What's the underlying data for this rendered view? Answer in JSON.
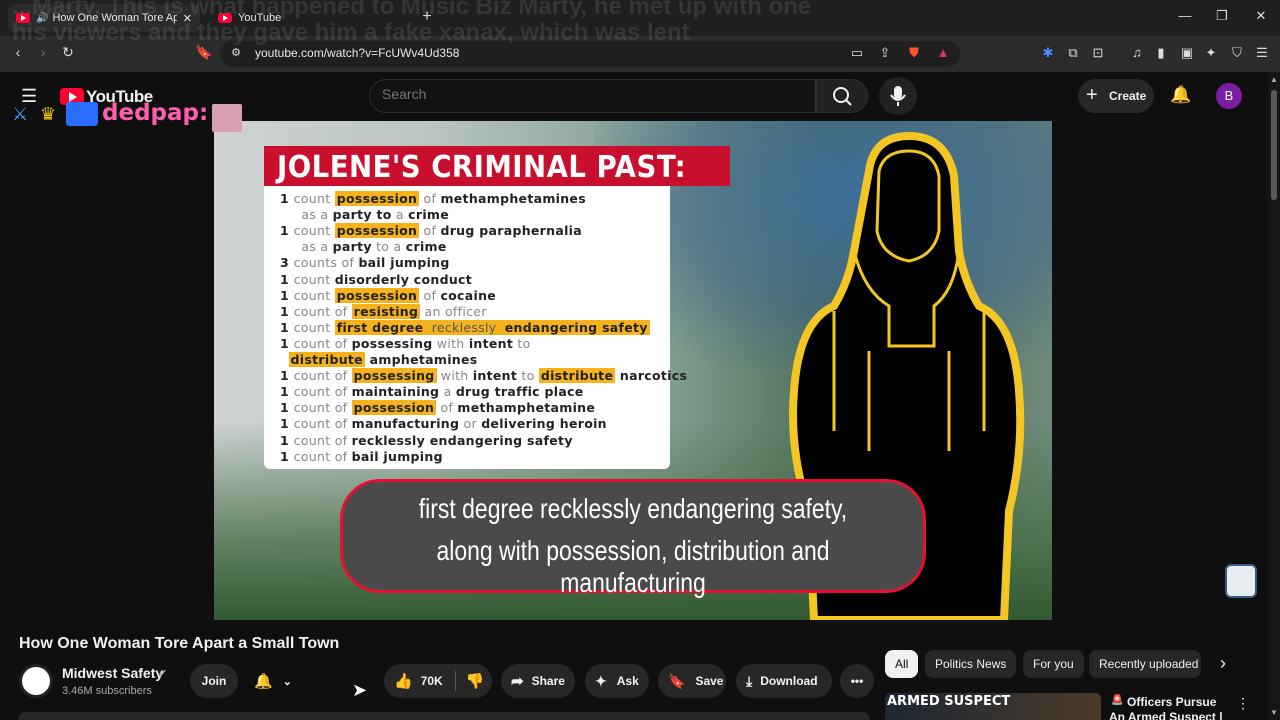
{
  "browser": {
    "tabs": [
      {
        "title": "How One Woman Tore Apart",
        "active": true
      },
      {
        "title": "YouTube",
        "active": false
      }
    ],
    "new_tab": "+",
    "url": "youtube.com/watch?v=FcUWv4Ud358",
    "window_controls": {
      "minimize": "—",
      "maximize": "❐",
      "close": "✕"
    }
  },
  "overlay": {
    "ghost_text": "...Marty. This is what happened to Music Biz Marty, he met up with one his viewers and they gave him a fake xanax, which was lent",
    "watermark": "dedpap:"
  },
  "youtube_header": {
    "logo_text": "YouTube",
    "search_placeholder": "Search",
    "create_label": "Create",
    "avatar_letter": "B"
  },
  "video_frame": {
    "banner_title": "JOLENE'S CRIMINAL PAST:",
    "charges": [
      [
        {
          "t": "1 ",
          "c": "n"
        },
        {
          "t": "count ",
          "c": "l"
        },
        {
          "t": "possession",
          "c": "h"
        },
        {
          "t": " of ",
          "c": "l"
        },
        {
          "t": "methamphetamines",
          "c": "k"
        }
      ],
      [
        {
          "t": "     as a ",
          "c": "l"
        },
        {
          "t": "party to",
          "c": "k"
        },
        {
          "t": " a ",
          "c": "l"
        },
        {
          "t": "crime",
          "c": "k"
        }
      ],
      [
        {
          "t": "1 ",
          "c": "n"
        },
        {
          "t": "count ",
          "c": "l"
        },
        {
          "t": "possession",
          "c": "h"
        },
        {
          "t": " of ",
          "c": "l"
        },
        {
          "t": "drug paraphernalia",
          "c": "k"
        }
      ],
      [
        {
          "t": "     as a ",
          "c": "l"
        },
        {
          "t": "party",
          "c": "k"
        },
        {
          "t": " to a ",
          "c": "l"
        },
        {
          "t": "crime",
          "c": "k"
        }
      ],
      [
        {
          "t": "3 ",
          "c": "n"
        },
        {
          "t": "counts of ",
          "c": "l"
        },
        {
          "t": "bail jumping",
          "c": "k"
        }
      ],
      [
        {
          "t": "1 ",
          "c": "n"
        },
        {
          "t": "count ",
          "c": "l"
        },
        {
          "t": "disorderly conduct",
          "c": "k"
        }
      ],
      [
        {
          "t": "1 ",
          "c": "n"
        },
        {
          "t": "count ",
          "c": "l"
        },
        {
          "t": "possession",
          "c": "h"
        },
        {
          "t": " of ",
          "c": "l"
        },
        {
          "t": "cocaine",
          "c": "k"
        }
      ],
      [
        {
          "t": "1 ",
          "c": "n"
        },
        {
          "t": "count of ",
          "c": "l"
        },
        {
          "t": "resisting",
          "c": "h"
        },
        {
          "t": " an officer",
          "c": "l"
        }
      ],
      [
        {
          "t": "1 ",
          "c": "n"
        },
        {
          "t": "count ",
          "c": "l"
        },
        {
          "t": "first degree",
          "c": "h"
        },
        {
          "t": " recklessly ",
          "c": "hl"
        },
        {
          "t": "endangering safety",
          "c": "h"
        }
      ],
      [
        {
          "t": "1 ",
          "c": "n"
        },
        {
          "t": "count of ",
          "c": "l"
        },
        {
          "t": "possessing",
          "c": "k"
        },
        {
          "t": " with ",
          "c": "l"
        },
        {
          "t": "intent",
          "c": "k"
        },
        {
          "t": " to",
          "c": "l"
        }
      ],
      [
        {
          "t": "  ",
          "c": "l"
        },
        {
          "t": "distribute",
          "c": "h"
        },
        {
          "t": " amphetamines",
          "c": "k"
        }
      ],
      [
        {
          "t": "1 ",
          "c": "n"
        },
        {
          "t": "count of ",
          "c": "l"
        },
        {
          "t": "possessing",
          "c": "h"
        },
        {
          "t": " with ",
          "c": "l"
        },
        {
          "t": "intent",
          "c": "k"
        },
        {
          "t": " to ",
          "c": "l"
        },
        {
          "t": "distribute",
          "c": "h"
        },
        {
          "t": " narcotics",
          "c": "k"
        }
      ],
      [
        {
          "t": "1 ",
          "c": "n"
        },
        {
          "t": "count of ",
          "c": "l"
        },
        {
          "t": "maintaining",
          "c": "k"
        },
        {
          "t": " a ",
          "c": "l"
        },
        {
          "t": "drug traffic place",
          "c": "k"
        }
      ],
      [
        {
          "t": "1 ",
          "c": "n"
        },
        {
          "t": "count of ",
          "c": "l"
        },
        {
          "t": "possession",
          "c": "h"
        },
        {
          "t": " of ",
          "c": "l"
        },
        {
          "t": "methamphetamine",
          "c": "k"
        }
      ],
      [
        {
          "t": "1 ",
          "c": "n"
        },
        {
          "t": "count of ",
          "c": "l"
        },
        {
          "t": "manufacturing",
          "c": "k"
        },
        {
          "t": " or ",
          "c": "l"
        },
        {
          "t": "delivering heroin",
          "c": "k"
        }
      ],
      [
        {
          "t": "1 ",
          "c": "n"
        },
        {
          "t": "count of ",
          "c": "l"
        },
        {
          "t": "recklessly endangering safety",
          "c": "k"
        }
      ],
      [
        {
          "t": "1 ",
          "c": "n"
        },
        {
          "t": "count of ",
          "c": "l"
        },
        {
          "t": "bail jumping",
          "c": "k"
        }
      ]
    ],
    "caption_line1": "first degree recklessly endangering safety,",
    "caption_line2": "along with possession, distribution and manufacturing"
  },
  "video_info": {
    "title": "How One Woman Tore Apart a Small Town",
    "channel": "Midwest Safety",
    "subscribers": "3.46M subscribers",
    "join_label": "Join",
    "like_count": "70K",
    "share_label": "Share",
    "ask_label": "Ask",
    "save_label": "Save",
    "download_label": "Download"
  },
  "chips": [
    "All",
    "Politics News",
    "For you",
    "Recently uploaded"
  ],
  "recommended": {
    "thumb_text": "ARMED SUSPECT",
    "title": "Officers Pursue An Armed Suspect | Cop"
  },
  "colors": {
    "accent_red": "#c8102e",
    "highlight": "#f5b21b",
    "outline_yellow": "#f3c623"
  }
}
